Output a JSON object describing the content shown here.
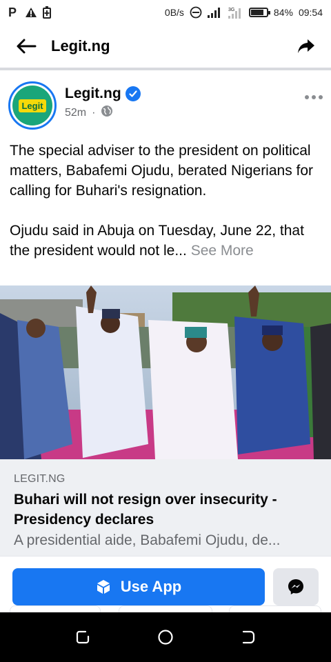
{
  "status_bar": {
    "left_icons": [
      "parking-icon",
      "warning-icon",
      "battery-saver-icon"
    ],
    "network_speed": "0B/s",
    "battery_percent": "84%",
    "time": "09:54",
    "battery_level": 0.84
  },
  "header": {
    "title": "Legit.ng",
    "back_icon": "arrow-left-icon",
    "share_icon": "share-icon"
  },
  "post": {
    "page_name": "Legit.ng",
    "avatar_logo_text": "Legit",
    "time_ago": "52m",
    "separator": "·",
    "paragraph_1": "The special adviser to the president on political matters, Babafemi Ojudu, berated Nigerians for calling for Buhari's resignation.",
    "paragraph_2": "Ojudu said in Abuja on Tuesday, June 22, that the president would not le...",
    "see_more": "See More"
  },
  "link_preview": {
    "domain": "LEGIT.NG",
    "title": "Buhari will not resign over insecurity - Presidency declares",
    "description": "A presidential aide, Babafemi Ojudu, de..."
  },
  "action_bar": {
    "use_app_label": "Use App"
  },
  "colors": {
    "brand_blue": "#1877f2",
    "link_card_bg": "#eef0f3",
    "secondary_text": "#65676b"
  }
}
